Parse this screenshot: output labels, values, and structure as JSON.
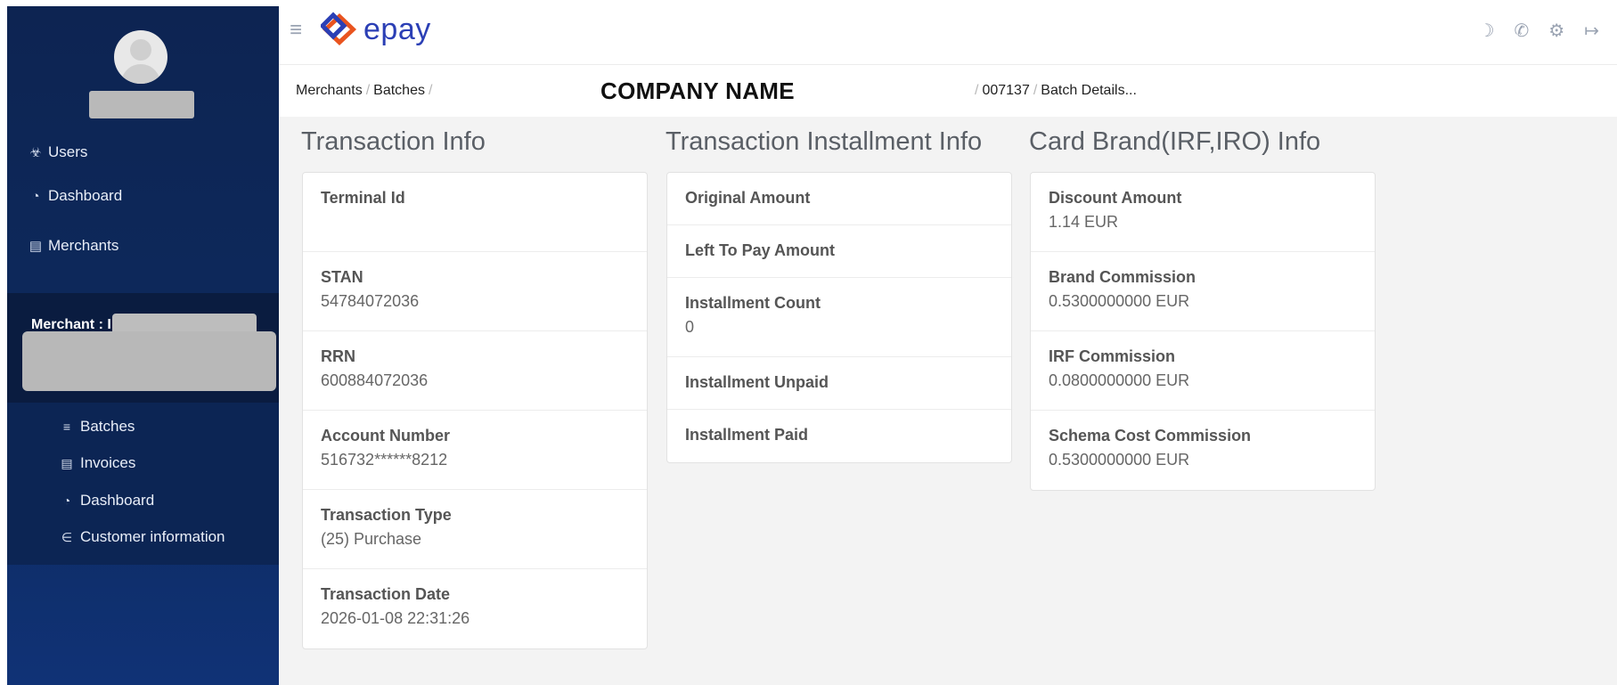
{
  "sidebar": {
    "nav": [
      {
        "icon": "users-icon",
        "label": "Users"
      },
      {
        "icon": "dashboard-icon",
        "label": "Dashboard"
      },
      {
        "icon": "merchants-icon",
        "label": "Merchants"
      }
    ],
    "merchant_label": "Merchant : I",
    "sub_items": [
      {
        "icon": "batches-icon",
        "label": "Batches"
      },
      {
        "icon": "invoices-icon",
        "label": "Invoices"
      },
      {
        "icon": "dashboard-icon",
        "label": "Dashboard"
      },
      {
        "icon": "customer-icon",
        "label": "Customer information"
      }
    ]
  },
  "header": {
    "logo_text": "epay",
    "brand_color": "#2b3fb5",
    "icons": [
      "moon-icon",
      "phone-icon",
      "settings-icon",
      "logout-icon"
    ]
  },
  "breadcrumb": {
    "merchants": "Merchants",
    "batches": "Batches",
    "company": "COMPANY NAME",
    "batch_id": "007137",
    "current": "Batch Details..."
  },
  "sections": {
    "transaction_info": {
      "title": "Transaction Info",
      "rows": [
        {
          "label": "Terminal Id",
          "value": ""
        },
        {
          "label": "STAN",
          "value": "54784072036"
        },
        {
          "label": "RRN",
          "value": "600884072036"
        },
        {
          "label": "Account Number",
          "value": "516732******8212"
        },
        {
          "label": "Transaction Type",
          "value": "(25) Purchase"
        },
        {
          "label": "Transaction Date",
          "value": "2026-01-08 22:31:26"
        }
      ]
    },
    "installment_info": {
      "title": "Transaction Installment Info",
      "rows": [
        {
          "label": "Original Amount",
          "value": ""
        },
        {
          "label": "Left To Pay Amount",
          "value": ""
        },
        {
          "label": "Installment Count",
          "value": "0"
        },
        {
          "label": "Installment Unpaid",
          "value": ""
        },
        {
          "label": "Installment Paid",
          "value": ""
        }
      ]
    },
    "card_brand_info": {
      "title": "Card Brand(IRF,IRO) Info",
      "rows": [
        {
          "label": "Discount Amount",
          "value": "1.14 EUR"
        },
        {
          "label": "Brand Commission",
          "value": "0.5300000000 EUR"
        },
        {
          "label": "IRF Commission",
          "value": "0.0800000000 EUR"
        },
        {
          "label": "Schema Cost Commission",
          "value": "0.5300000000 EUR"
        }
      ]
    }
  }
}
